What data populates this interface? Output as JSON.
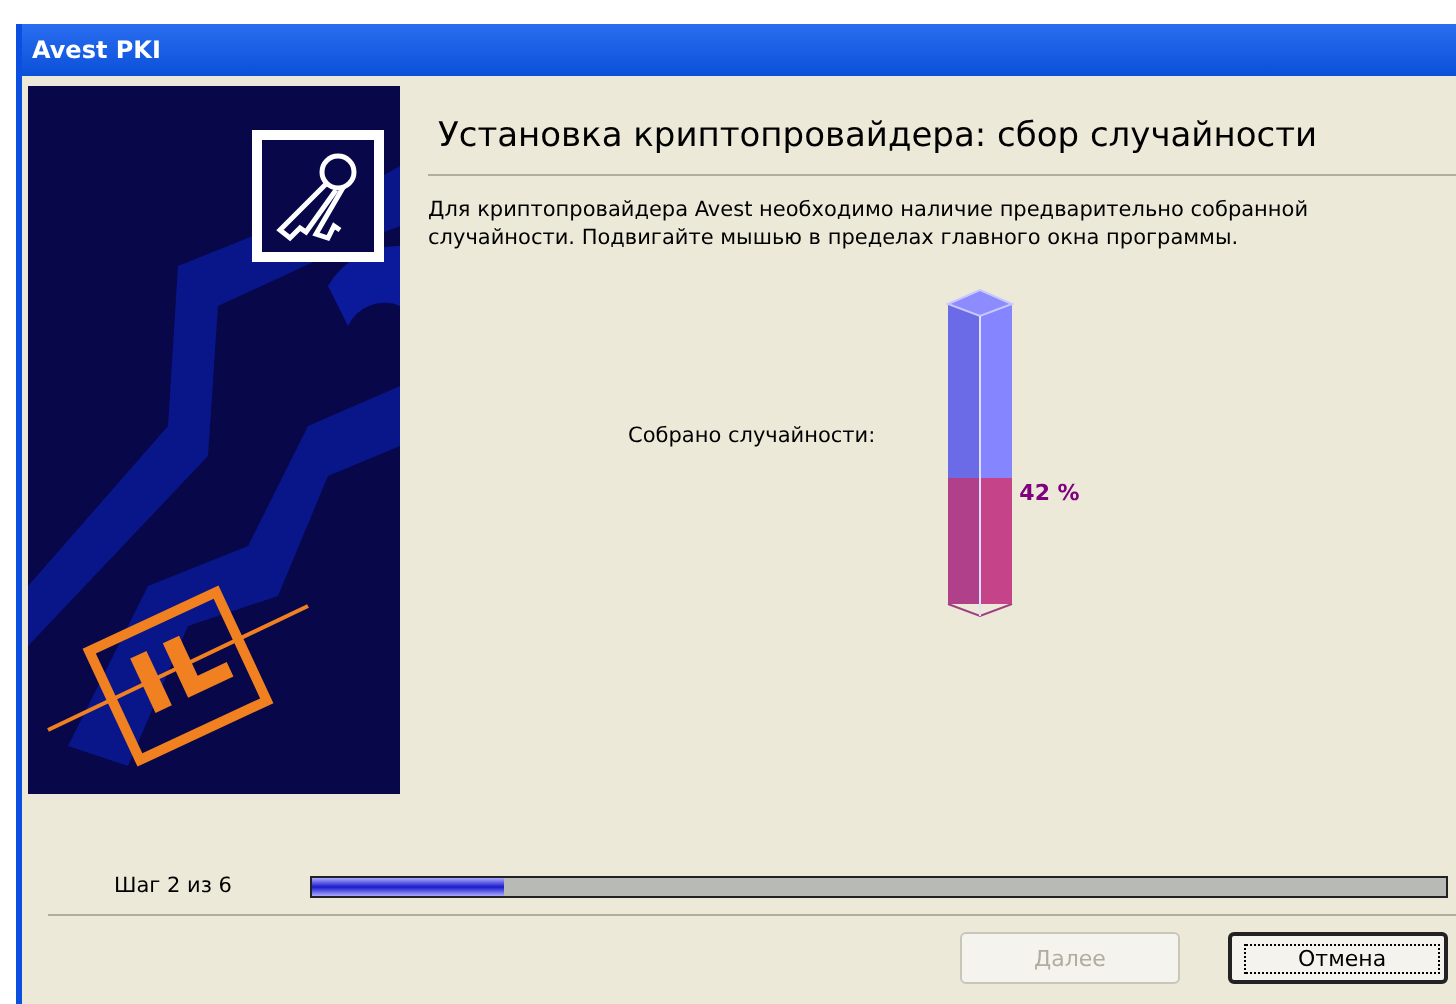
{
  "window": {
    "title": "Avest PKI"
  },
  "header": {
    "title": "Установка криптопровайдера: сбор случайности"
  },
  "description": "Для криптопровайдера Avest необходимо наличие предварительно собранной случайности. Подвигайте мышью в пределах главного окна программы.",
  "gauge": {
    "label": "Собрано случайности:",
    "level": 0.42,
    "reading": "42 %"
  },
  "step": {
    "label": "Шаг 2 из 6",
    "level": 0.17
  },
  "buttons": [
    {
      "label": "Далее",
      "disabled": true,
      "focused": false
    },
    {
      "label": "Отмена",
      "disabled": false,
      "focused": true
    }
  ]
}
